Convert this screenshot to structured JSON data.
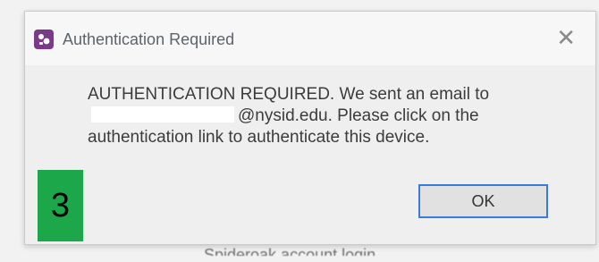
{
  "dialog": {
    "title": "Authentication Required",
    "close_symbol": "✕",
    "message_part1": "AUTHENTICATION REQUIRED. We sent an email to",
    "message_part2": "@nysid.edu. Please click on the authentication link to authenticate this device.",
    "ok_label": "OK"
  },
  "step_badge": "3",
  "background_link": "Spideroak account login",
  "colors": {
    "badge": "#1ca84a",
    "ok_border": "#3b7ad6",
    "app_icon": "#7a3a8a"
  },
  "icons": {
    "app": "app-logo-icon",
    "close": "close-icon"
  }
}
